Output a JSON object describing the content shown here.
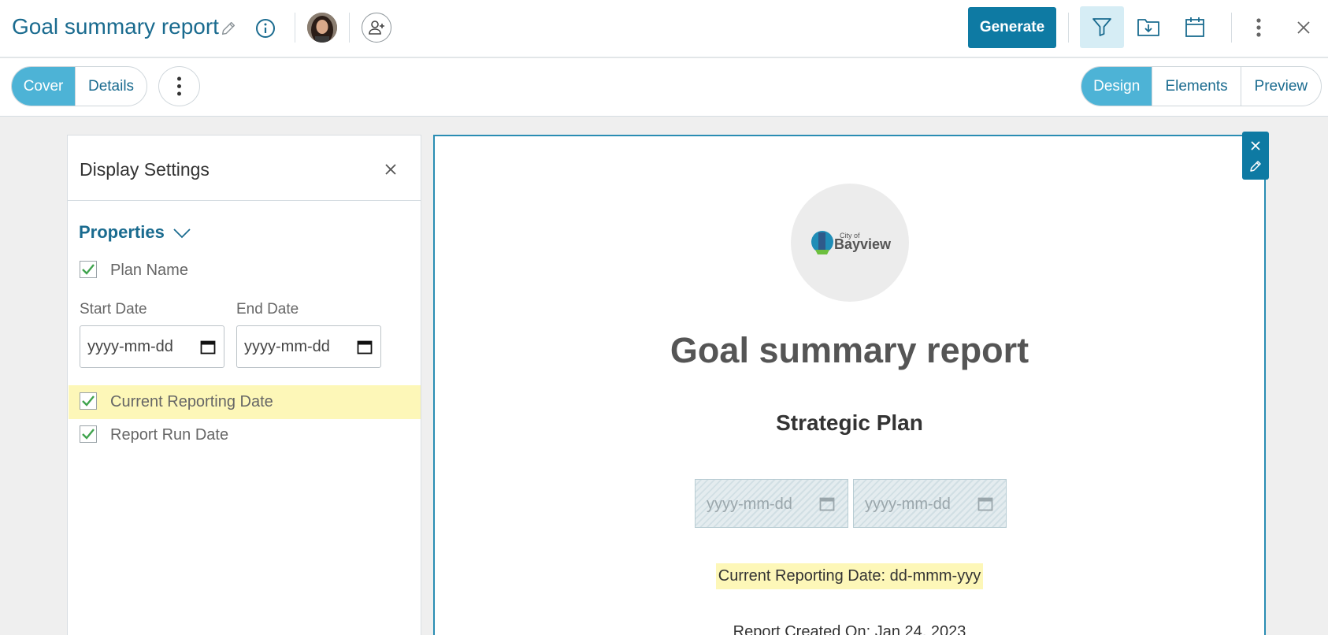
{
  "header": {
    "title": "Goal summary report",
    "generate_label": "Generate",
    "accent_color": "#0e7aa3"
  },
  "icons": {
    "edit": "pencil-icon",
    "info": "info-icon",
    "add_user": "add-user-icon",
    "filter": "filter-icon",
    "folder": "folder-download-icon",
    "calendar": "calendar-icon",
    "more": "more-vertical-icon",
    "close": "close-icon"
  },
  "tabs_left": [
    {
      "label": "Cover",
      "active": true
    },
    {
      "label": "Details",
      "active": false
    }
  ],
  "tabs_right": [
    {
      "label": "Design",
      "active": true
    },
    {
      "label": "Elements",
      "active": false
    },
    {
      "label": "Preview",
      "active": false
    }
  ],
  "panel": {
    "title": "Display Settings",
    "properties_label": "Properties",
    "plan_name_label": "Plan Name",
    "plan_name_checked": true,
    "start_date_label": "Start Date",
    "start_date_placeholder": "yyyy-mm-dd",
    "end_date_label": "End Date",
    "end_date_placeholder": "yyyy-mm-dd",
    "current_reporting_label": "Current Reporting Date",
    "current_reporting_checked": true,
    "report_run_label": "Report Run Date",
    "report_run_checked": true
  },
  "canvas": {
    "logo_small": "City of",
    "logo_big": "Bayview",
    "report_title": "Goal summary report",
    "plan_title": "Strategic Plan",
    "start_placeholder": "yyyy-mm-dd",
    "end_placeholder": "yyyy-mm-dd",
    "current_reporting_text": "Current Reporting Date: dd-mmm-yyy",
    "created_text": "Report Created On: Jan 24, 2023"
  }
}
